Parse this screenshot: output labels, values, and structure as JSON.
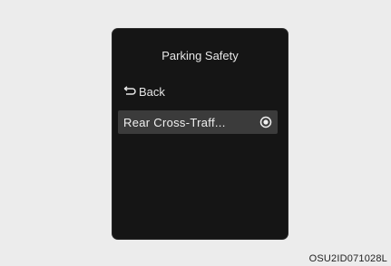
{
  "screen": {
    "title": "Parking Safety",
    "back_label": "Back",
    "back_icon": "return-arrow-icon",
    "items": [
      {
        "label": "Rear Cross-Traff...",
        "selected": true,
        "control_icon": "radio-selected-icon"
      }
    ]
  },
  "figure_code": "OSU2ID071028L"
}
